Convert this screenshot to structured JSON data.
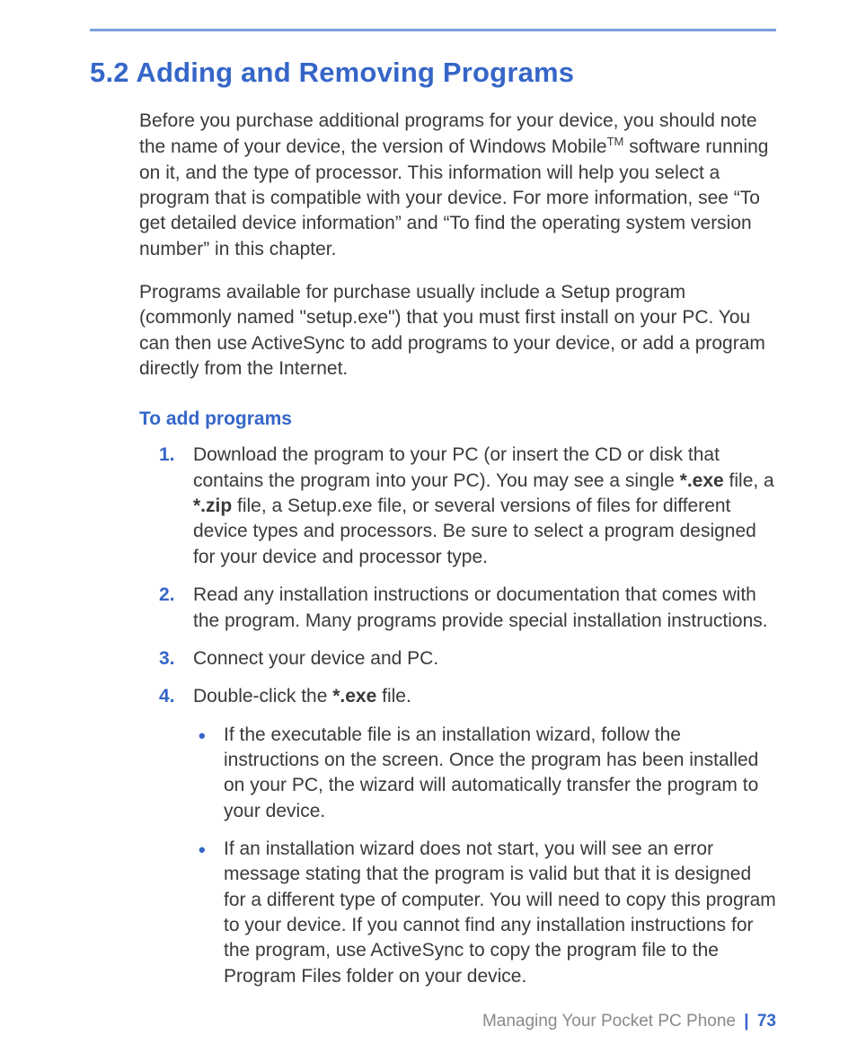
{
  "heading": "5.2  Adding and Removing Programs",
  "para1_a": "Before you purchase additional programs for your device, you should note the name of your device, the version of Windows Mobile",
  "para1_tm": "TM",
  "para1_b": " software running on it, and the type of processor. This information will help you select a program that is compatible with your device. For more information, see “To get detailed device information” and “To find the operating system version number” in this chapter.",
  "para2": "Programs available for purchase usually include a Setup program (commonly named \"setup.exe\") that you must first install on your PC. You can then use ActiveSync to add programs to your device, or add a program directly from the Internet.",
  "subhead": "To add programs",
  "steps": {
    "s1": {
      "num": "1.",
      "a": "Download the program to your PC (or insert the CD or disk that contains the program into your PC). You may see a single ",
      "b1": "*.exe",
      "b": " file, a ",
      "b2": "*.zip",
      "c": " file, a Setup.exe file, or several versions of files for different device types and processors. Be sure to select a program designed for your device and processor type."
    },
    "s2": {
      "num": "2.",
      "text": "Read any installation instructions or documentation that comes with the program. Many programs provide special installation instructions."
    },
    "s3": {
      "num": "3.",
      "text": "Connect your device and PC."
    },
    "s4": {
      "num": "4.",
      "a": "Double-click the ",
      "b1": "*.exe",
      "b": " file.",
      "sub1": "If the executable file is an installation wizard, follow the instructions on the screen. Once the program has been installed on your PC, the wizard will automatically transfer the program to your device.",
      "sub2": "If an installation wizard does not start, you will see an error message stating that the program is valid but that it is designed for a different type of computer. You will need to copy this program to your device. If you cannot find any installation instructions for the program, use ActiveSync to copy the program file to the Program Files folder on your device."
    }
  },
  "footer": {
    "chapter": "Managing Your Pocket PC Phone",
    "divider": "|",
    "page": "73"
  }
}
